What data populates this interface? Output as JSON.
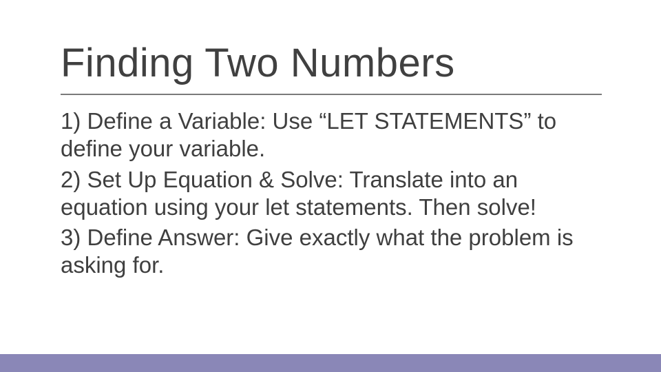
{
  "title": "Finding Two Numbers",
  "body": {
    "p1": "1) Define a Variable: Use “LET STATEMENTS” to define your variable.",
    "p2": "2) Set Up Equation & Solve: Translate into an equation using your let statements. Then solve!",
    "p3": "3) Define Answer: Give exactly what the problem is asking for."
  },
  "accent_color": "#8a87b7"
}
